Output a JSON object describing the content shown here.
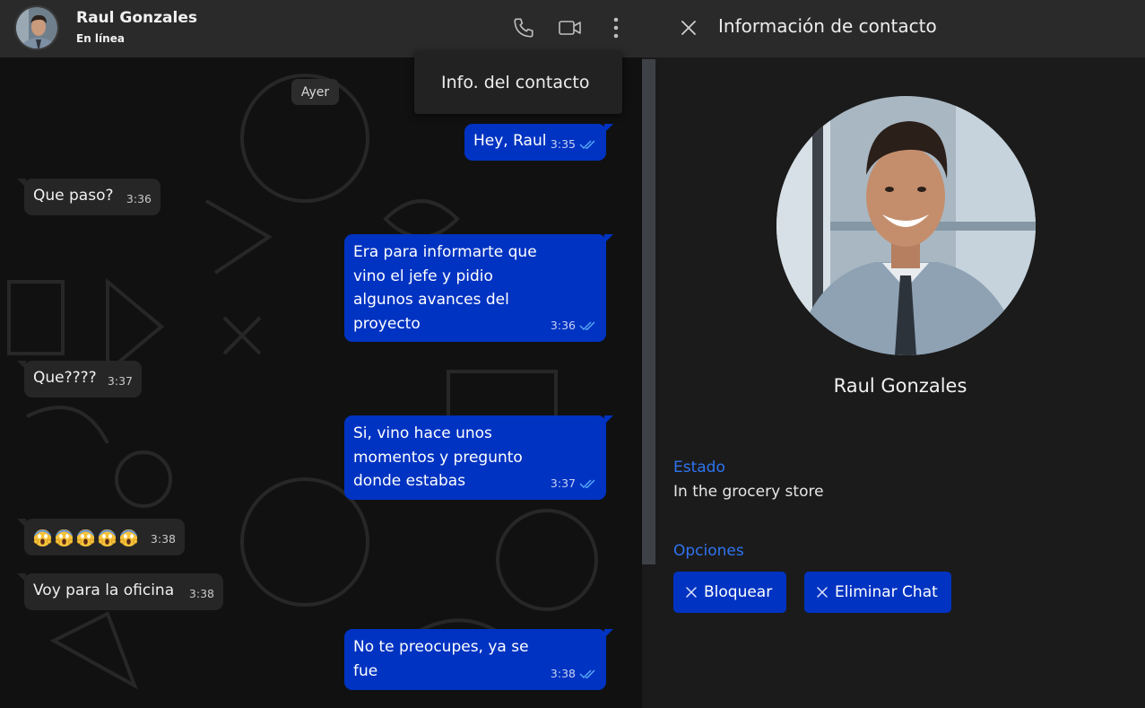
{
  "header": {
    "contact_name": "Raul Gonzales",
    "status": "En línea"
  },
  "menu": {
    "item_contact_info": "Info. del contacto"
  },
  "chat": {
    "date_separator": "Ayer",
    "messages": [
      {
        "dir": "out",
        "lines": [
          "Hey, Raul"
        ],
        "time": "3:35"
      },
      {
        "dir": "in",
        "lines": [
          "Que paso?"
        ],
        "time": "3:36"
      },
      {
        "dir": "out",
        "lines": [
          "Era para informarte que",
          "vino el jefe y pidio",
          "algunos avances del",
          "proyecto"
        ],
        "time": "3:36"
      },
      {
        "dir": "in",
        "lines": [
          "Que????"
        ],
        "time": "3:37"
      },
      {
        "dir": "out",
        "lines": [
          "Si, vino hace unos",
          "momentos y pregunto",
          "donde estabas"
        ],
        "time": "3:37"
      },
      {
        "dir": "in",
        "emoji": "face-screaming-in-fear",
        "emoji_count": 5,
        "time": "3:38"
      },
      {
        "dir": "in",
        "lines": [
          "Voy para la oficina"
        ],
        "time": "3:38"
      },
      {
        "dir": "out",
        "lines": [
          "No te preocupes, ya se",
          "fue"
        ],
        "time": "3:38"
      }
    ]
  },
  "info_panel": {
    "title": "Información de contacto",
    "name": "Raul Gonzales",
    "status_label": "Estado",
    "status_value": "In the grocery store",
    "options_label": "Opciones",
    "block_label": "Bloquear",
    "delete_chat_label": "Eliminar Chat"
  },
  "colors": {
    "outgoing_bubble": "#0033c2",
    "incoming_bubble": "#262626",
    "accent_label": "#2f74f0",
    "read_ticks": "#5aa9f5"
  }
}
